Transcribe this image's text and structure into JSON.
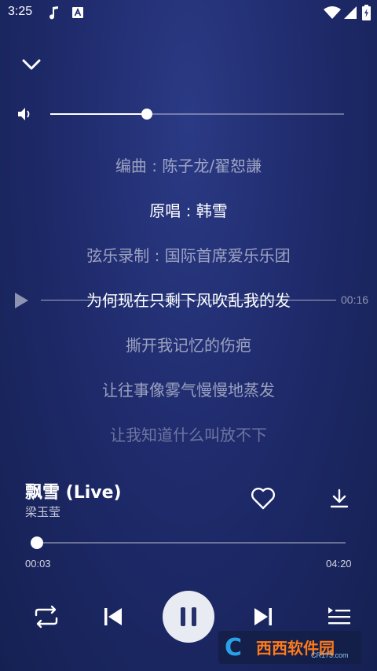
{
  "status_bar": {
    "time": "3:25"
  },
  "volume": {
    "level": 0.33
  },
  "lyrics": [
    {
      "text": "编曲 : 陈子龙/翟恕謙",
      "state": "dim"
    },
    {
      "text": "原唱 : 韩雪",
      "state": "active"
    },
    {
      "text": "弦乐录制 : 国际首席爱乐乐团",
      "state": "dim"
    },
    {
      "text": "为何现在只剩下风吹乱我的发",
      "state": "seek"
    },
    {
      "text": "撕开我记忆的伤疤",
      "state": "dim"
    },
    {
      "text": "让往事像雾气慢慢地蒸发",
      "state": "dim"
    },
    {
      "text": "让我知道什么叫放不下",
      "state": "faint"
    }
  ],
  "seek_preview": {
    "time": "00:16"
  },
  "song": {
    "title": "飘雪 (Live)",
    "artist": "梁玉莹"
  },
  "progress": {
    "elapsed": "00:03",
    "duration": "04:20",
    "fraction": 0.012
  },
  "watermark": {
    "logo": "C",
    "text": "西西软件园",
    "sub": "CR173.com"
  },
  "colors": {
    "accent": "#ffffff",
    "background": "#1f2b6c",
    "pause_glyph": "#26306a"
  },
  "icons": [
    "music-note-icon",
    "a-box-icon",
    "wifi-icon",
    "battery-charging-icon",
    "chevron-down-icon",
    "volume-icon",
    "play-icon",
    "heart-outline-icon",
    "download-icon",
    "repeat-icon",
    "skip-previous-icon",
    "pause-icon",
    "skip-next-icon",
    "playlist-icon"
  ]
}
